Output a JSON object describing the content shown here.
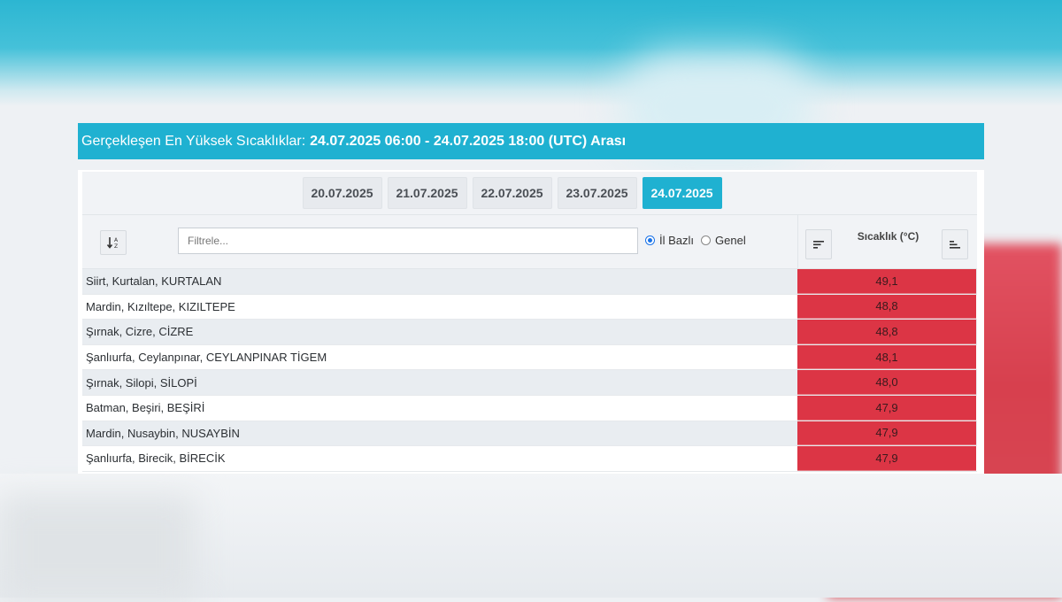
{
  "header": {
    "prefix": "Gerçekleşen En Yüksek Sıcaklıklar:",
    "range": "24.07.2025 06:00 - 24.07.2025 18:00 (UTC) Arası"
  },
  "tabs": [
    "20.07.2025",
    "21.07.2025",
    "22.07.2025",
    "23.07.2025",
    "24.07.2025"
  ],
  "active_tab": "24.07.2025",
  "toolbar": {
    "filter_placeholder": "Filtrele...",
    "filter_value": "",
    "radio_il": "İl Bazlı",
    "radio_genel": "Genel",
    "selected_radio": "İl Bazlı",
    "temp_header": "Sıcaklık (°C)"
  },
  "rows": [
    {
      "location": "Siirt, Kurtalan, KURTALAN",
      "temp": "49,1"
    },
    {
      "location": "Mardin, Kızıltepe, KIZILTEPE",
      "temp": "48,8"
    },
    {
      "location": "Şırnak, Cizre, CİZRE",
      "temp": "48,8"
    },
    {
      "location": "Şanlıurfa, Ceylanpınar, CEYLANPINAR TİGEM",
      "temp": "48,1"
    },
    {
      "location": "Şırnak, Silopi, SİLOPİ",
      "temp": "48,0"
    },
    {
      "location": "Batman, Beşiri, BEŞİRİ",
      "temp": "47,9"
    },
    {
      "location": "Mardin, Nusaybin, NUSAYBİN",
      "temp": "47,9"
    },
    {
      "location": "Şanlıurfa, Birecik, BİRECİK",
      "temp": "47,9"
    }
  ],
  "colors": {
    "accent": "#1fb1d1",
    "hot": "#dc3545"
  }
}
